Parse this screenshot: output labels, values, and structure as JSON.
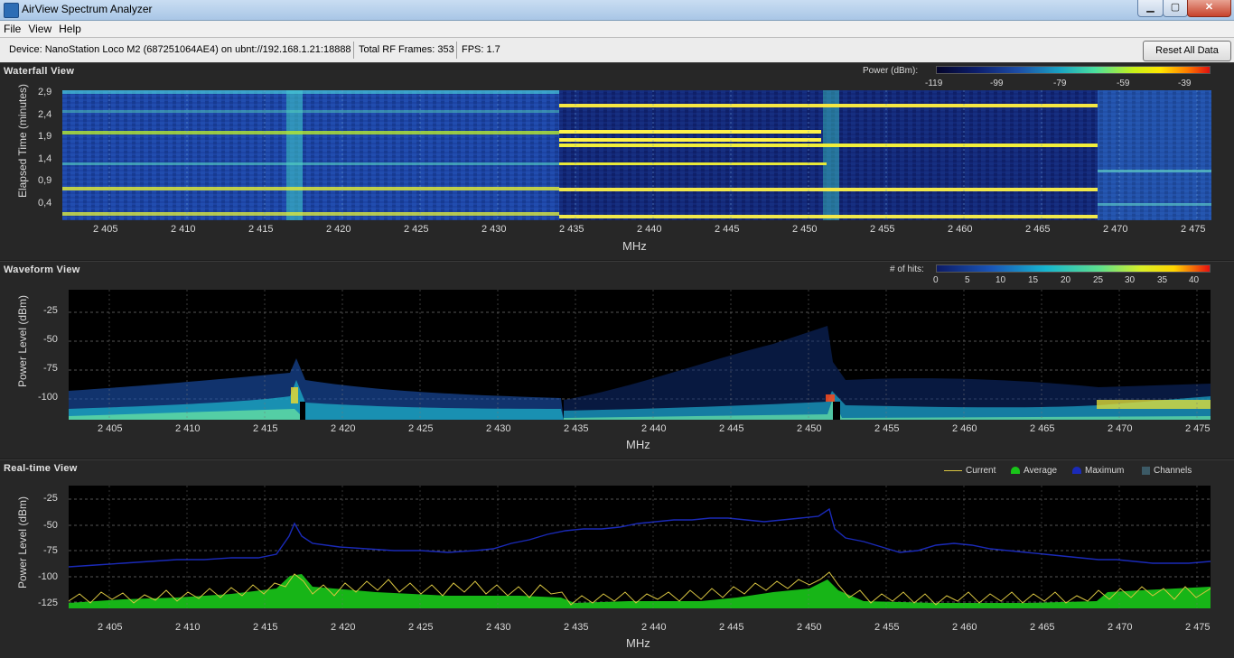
{
  "window": {
    "title": "AirView Spectrum Analyzer",
    "min_label": "▁",
    "max_label": "▢",
    "close_label": "✕"
  },
  "menu": [
    "File",
    "View",
    "Help"
  ],
  "infobar": {
    "device": "Device: NanoStation Loco M2 (687251064AE4) on ubnt://192.168.1.21:18888",
    "frames": "Total RF Frames: 353",
    "fps": "FPS: 1.7",
    "reset_label": "Reset All Data"
  },
  "x_ticks": [
    "2 405",
    "2 410",
    "2 415",
    "2 420",
    "2 425",
    "2 430",
    "2 435",
    "2 440",
    "2 445",
    "2 450",
    "2 455",
    "2 460",
    "2 465",
    "2 470",
    "2 475"
  ],
  "x_axis_title": "MHz",
  "waterfall": {
    "title": "Waterfall View",
    "ylabel": "Elapsed Time (minutes)",
    "y_ticks": [
      "2,9",
      "2,4",
      "1,9",
      "1,4",
      "0,9",
      "0,4"
    ],
    "legend_title": "Power (dBm):",
    "legend_ticks": [
      "-119",
      "-99",
      "-79",
      "-59",
      "-39"
    ]
  },
  "waveform": {
    "title": "Waveform View",
    "ylabel": "Power Level (dBm)",
    "y_ticks": [
      "-25",
      "-50",
      "-75",
      "-100"
    ],
    "legend_title": "# of hits:",
    "legend_ticks": [
      "0",
      "5",
      "10",
      "15",
      "20",
      "25",
      "30",
      "35",
      "40"
    ]
  },
  "realtime": {
    "title": "Real-time View",
    "ylabel": "Power Level (dBm)",
    "y_ticks": [
      "-25",
      "-50",
      "-75",
      "-100",
      "-125"
    ],
    "legend": [
      {
        "label": "Current",
        "color": "#d8c441"
      },
      {
        "label": "Average",
        "color": "#19c419"
      },
      {
        "label": "Maximum",
        "color": "#1a2ab8"
      },
      {
        "label": "Channels",
        "color": "#3c5a66"
      }
    ]
  }
}
